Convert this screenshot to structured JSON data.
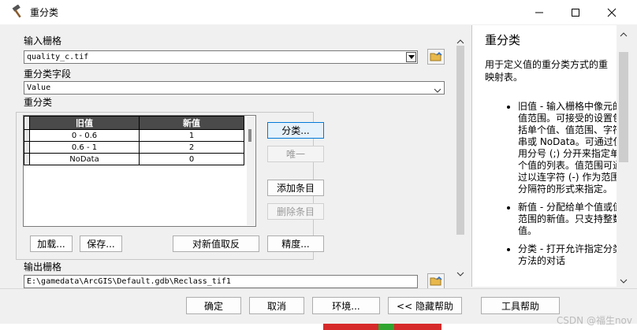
{
  "window": {
    "title": "重分类",
    "minimize_icon": "minimize-icon",
    "maximize_icon": "maximize-icon",
    "close_icon": "close-icon"
  },
  "form": {
    "input_raster_label": "输入栅格",
    "input_raster_value": "quality_c.tif",
    "reclass_field_label": "重分类字段",
    "reclass_field_value": "Value",
    "reclass_label": "重分类",
    "table": {
      "headers": [
        "旧值",
        "新值"
      ],
      "rows": [
        {
          "old": "0 - 0.6",
          "new": "1"
        },
        {
          "old": "0.6 - 1",
          "new": "2"
        },
        {
          "old": "NoData",
          "new": "0"
        }
      ]
    },
    "buttons": {
      "classify": "分类...",
      "unique": "唯一",
      "add_entry": "添加条目",
      "delete_entry": "删除条目",
      "load": "加载...",
      "save": "保存...",
      "reverse": "对新值取反",
      "precision": "精度..."
    },
    "output_raster_label": "输出栅格",
    "output_raster_value": "E:\\gamedata\\ArcGIS\\Default.gdb\\Reclass_tif1"
  },
  "help": {
    "title": "重分类",
    "intro": "用于定义值的重分类方式的重映射表。",
    "items": [
      "旧值 - 输入栅格中像元的值范围。可接受的设置包括单个值、值范围、字符串或 NoData。可通过使用分号 (;) 分开来指定单个值的列表。值范围可通过以连字符 (-) 作为范围分隔符的形式来指定。",
      "新值 - 分配给单个值或值范围的新值。只支持整数值。",
      "分类 - 打开允许指定分类方法的对话"
    ]
  },
  "footer": {
    "ok": "确定",
    "cancel": "取消",
    "environments": "环境...",
    "hide_help": "<< 隐藏帮助",
    "tool_help": "工具帮助"
  },
  "watermark": "CSDN @福生nov"
}
